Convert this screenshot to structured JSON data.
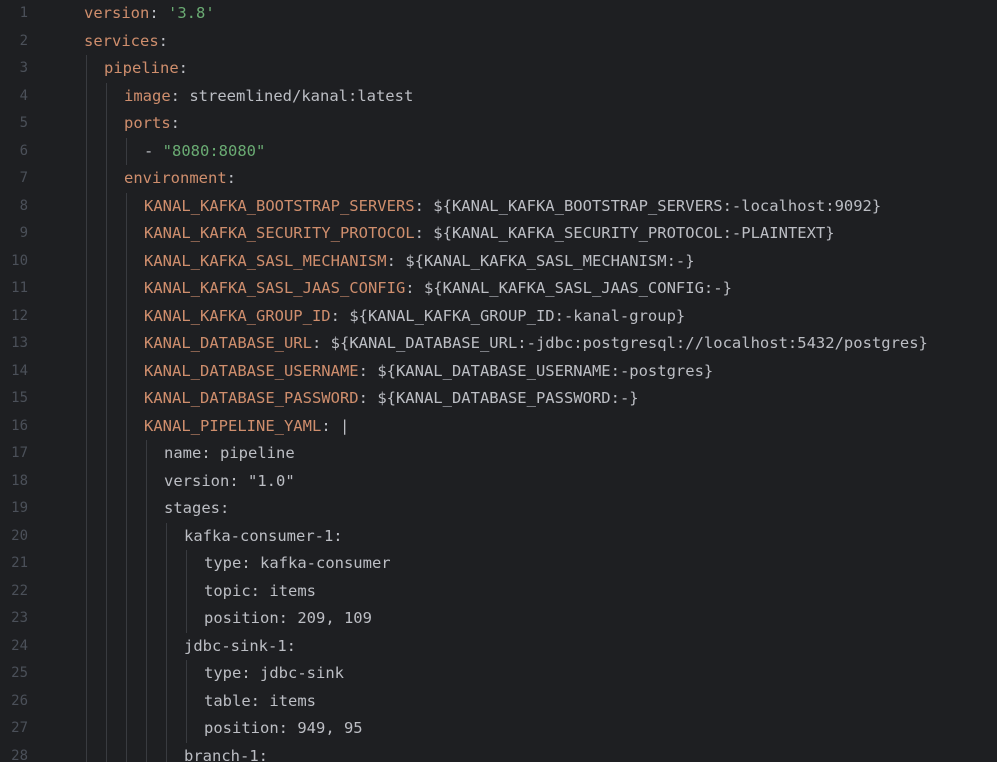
{
  "editor": {
    "lines": [
      {
        "n": "1",
        "indent": 0,
        "key": "version",
        "sep": ": ",
        "value": "'3.8'",
        "vtype": "str",
        "ktype": "key"
      },
      {
        "n": "2",
        "indent": 0,
        "key": "services",
        "sep": ":",
        "value": "",
        "vtype": "txt",
        "ktype": "key"
      },
      {
        "n": "3",
        "indent": 1,
        "key": "pipeline",
        "sep": ":",
        "value": "",
        "vtype": "txt",
        "ktype": "key"
      },
      {
        "n": "4",
        "indent": 2,
        "key": "image",
        "sep": ": ",
        "value": "streemlined/kanal:latest",
        "vtype": "txt",
        "ktype": "key"
      },
      {
        "n": "5",
        "indent": 2,
        "key": "ports",
        "sep": ":",
        "value": "",
        "vtype": "txt",
        "ktype": "key"
      },
      {
        "n": "6",
        "indent": 3,
        "key": "- ",
        "sep": "",
        "value": "\"8080:8080\"",
        "vtype": "str",
        "ktype": "txt"
      },
      {
        "n": "7",
        "indent": 2,
        "key": "environment",
        "sep": ":",
        "value": "",
        "vtype": "txt",
        "ktype": "key"
      },
      {
        "n": "8",
        "indent": 3,
        "key": "KANAL_KAFKA_BOOTSTRAP_SERVERS",
        "sep": ": ",
        "value": "${KANAL_KAFKA_BOOTSTRAP_SERVERS:-localhost:9092}",
        "vtype": "txt",
        "ktype": "key"
      },
      {
        "n": "9",
        "indent": 3,
        "key": "KANAL_KAFKA_SECURITY_PROTOCOL",
        "sep": ": ",
        "value": "${KANAL_KAFKA_SECURITY_PROTOCOL:-PLAINTEXT}",
        "vtype": "txt",
        "ktype": "key"
      },
      {
        "n": "10",
        "indent": 3,
        "key": "KANAL_KAFKA_SASL_MECHANISM",
        "sep": ": ",
        "value": "${KANAL_KAFKA_SASL_MECHANISM:-}",
        "vtype": "txt",
        "ktype": "key"
      },
      {
        "n": "11",
        "indent": 3,
        "key": "KANAL_KAFKA_SASL_JAAS_CONFIG",
        "sep": ": ",
        "value": "${KANAL_KAFKA_SASL_JAAS_CONFIG:-}",
        "vtype": "txt",
        "ktype": "key"
      },
      {
        "n": "12",
        "indent": 3,
        "key": "KANAL_KAFKA_GROUP_ID",
        "sep": ": ",
        "value": "${KANAL_KAFKA_GROUP_ID:-kanal-group}",
        "vtype": "txt",
        "ktype": "key"
      },
      {
        "n": "13",
        "indent": 3,
        "key": "KANAL_DATABASE_URL",
        "sep": ": ",
        "value": "${KANAL_DATABASE_URL:-jdbc:postgresql://localhost:5432/postgres}",
        "vtype": "txt",
        "ktype": "key"
      },
      {
        "n": "14",
        "indent": 3,
        "key": "KANAL_DATABASE_USERNAME",
        "sep": ": ",
        "value": "${KANAL_DATABASE_USERNAME:-postgres}",
        "vtype": "txt",
        "ktype": "key"
      },
      {
        "n": "15",
        "indent": 3,
        "key": "KANAL_DATABASE_PASSWORD",
        "sep": ": ",
        "value": "${KANAL_DATABASE_PASSWORD:-}",
        "vtype": "txt",
        "ktype": "key"
      },
      {
        "n": "16",
        "indent": 3,
        "key": "KANAL_PIPELINE_YAML",
        "sep": ": ",
        "value": "|",
        "vtype": "txt",
        "ktype": "key"
      },
      {
        "n": "17",
        "indent": 4,
        "key": "name: pipeline",
        "sep": "",
        "value": "",
        "vtype": "txt",
        "ktype": "txt"
      },
      {
        "n": "18",
        "indent": 4,
        "key": "version: \"1.0\"",
        "sep": "",
        "value": "",
        "vtype": "txt",
        "ktype": "txt"
      },
      {
        "n": "19",
        "indent": 4,
        "key": "stages:",
        "sep": "",
        "value": "",
        "vtype": "txt",
        "ktype": "txt"
      },
      {
        "n": "20",
        "indent": 5,
        "key": "kafka-consumer-1:",
        "sep": "",
        "value": "",
        "vtype": "txt",
        "ktype": "txt"
      },
      {
        "n": "21",
        "indent": 6,
        "key": "type: kafka-consumer",
        "sep": "",
        "value": "",
        "vtype": "txt",
        "ktype": "txt"
      },
      {
        "n": "22",
        "indent": 6,
        "key": "topic: items",
        "sep": "",
        "value": "",
        "vtype": "txt",
        "ktype": "txt"
      },
      {
        "n": "23",
        "indent": 6,
        "key": "position: 209, 109",
        "sep": "",
        "value": "",
        "vtype": "txt",
        "ktype": "txt"
      },
      {
        "n": "24",
        "indent": 5,
        "key": "jdbc-sink-1:",
        "sep": "",
        "value": "",
        "vtype": "txt",
        "ktype": "txt"
      },
      {
        "n": "25",
        "indent": 6,
        "key": "type: jdbc-sink",
        "sep": "",
        "value": "",
        "vtype": "txt",
        "ktype": "txt"
      },
      {
        "n": "26",
        "indent": 6,
        "key": "table: items",
        "sep": "",
        "value": "",
        "vtype": "txt",
        "ktype": "txt"
      },
      {
        "n": "27",
        "indent": 6,
        "key": "position: 949, 95",
        "sep": "",
        "value": "",
        "vtype": "txt",
        "ktype": "txt"
      },
      {
        "n": "28",
        "indent": 5,
        "key": "branch-1:",
        "sep": "",
        "value": "",
        "vtype": "txt",
        "ktype": "txt"
      }
    ]
  },
  "colors": {
    "background": "#1e1f22",
    "key": "#cf8e6d",
    "string": "#6aab73",
    "text": "#bcbec4",
    "line_number": "#4b5059",
    "indent_guide": "#393b40"
  }
}
